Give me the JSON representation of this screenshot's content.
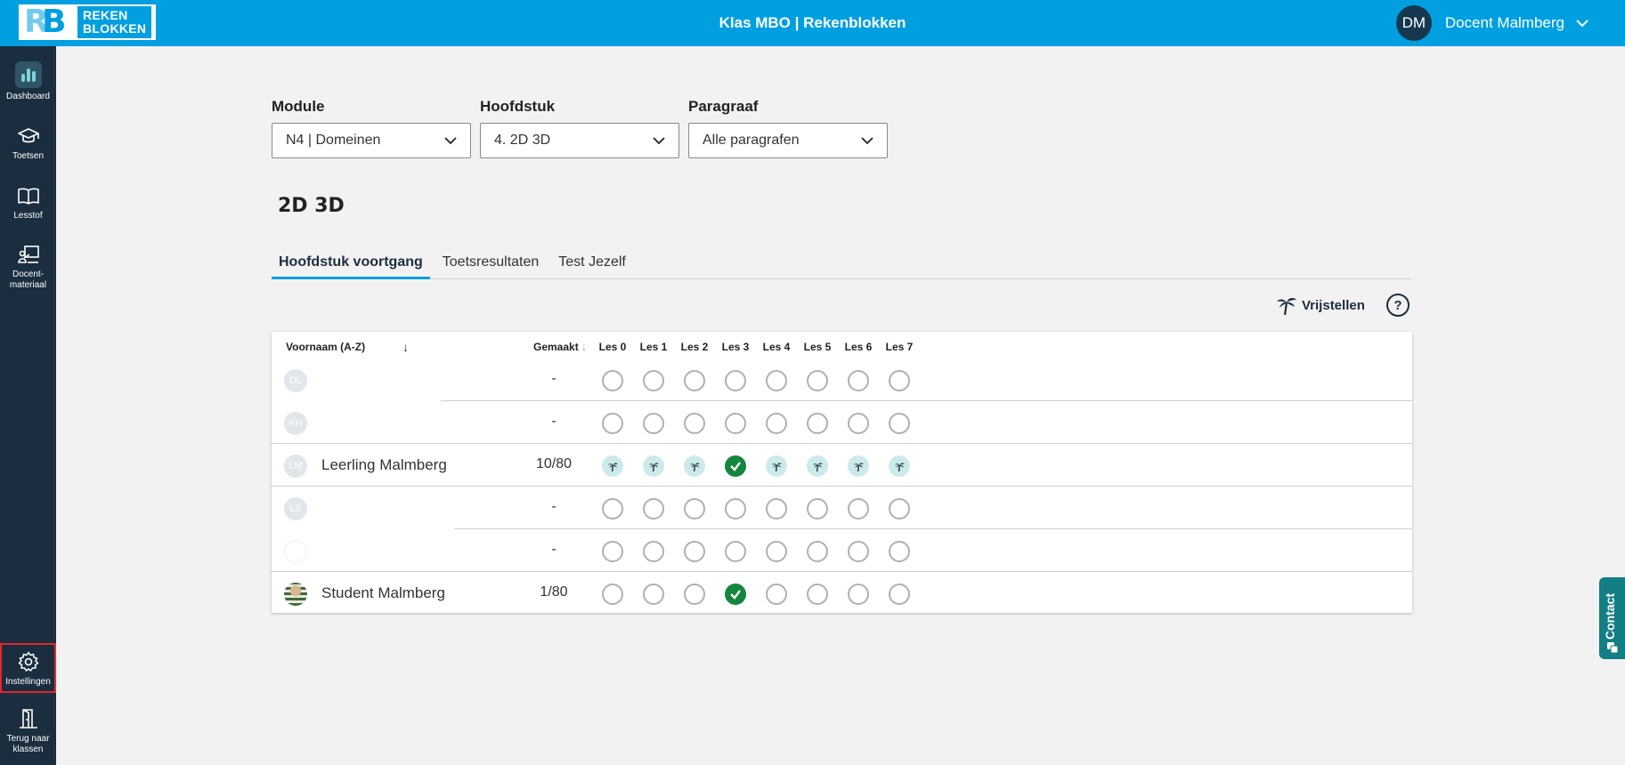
{
  "header": {
    "logo_text_line1": "REKEN",
    "logo_text_line2": "BLOKKEN",
    "logo_mark": "RB",
    "title": "Klas MBO | Rekenblokken",
    "user_initials": "DM",
    "user_name": "Docent Malmberg"
  },
  "sidebar": {
    "items": [
      {
        "label": "Dashboard",
        "icon": "bar-chart-icon"
      },
      {
        "label": "Toetsen",
        "icon": "graduation-cap-icon"
      },
      {
        "label": "Lesstof",
        "icon": "open-book-icon"
      },
      {
        "label": "Docent-materiaal",
        "label_line1": "Docent-",
        "label_line2": "materiaal",
        "icon": "teacher-board-icon"
      },
      {
        "label": "Instellingen",
        "icon": "gear-icon"
      },
      {
        "label": "Terug naar klassen",
        "label_line1": "Terug naar",
        "label_line2": "klassen",
        "icon": "door-exit-icon"
      }
    ]
  },
  "filters": {
    "module": {
      "label": "Module",
      "value": "N4 | Domeinen"
    },
    "chapter": {
      "label": "Hoofdstuk",
      "value": "4. 2D 3D"
    },
    "paragraph": {
      "label": "Paragraaf",
      "value": "Alle paragrafen"
    }
  },
  "chapter_title": "2D 3D",
  "tabs": [
    {
      "label": "Hoofdstuk voortgang",
      "active": true
    },
    {
      "label": "Toetsresultaten",
      "active": false
    },
    {
      "label": "Test Jezelf",
      "active": false
    }
  ],
  "actions": {
    "exempt_label": "Vrijstellen",
    "help_label": "?"
  },
  "table": {
    "col_name": "Voornaam (A-Z)",
    "col_name_sort": "↓",
    "col_made": "Gemaakt",
    "col_made_sort": "↓",
    "lessons": [
      "Les 0",
      "Les 1",
      "Les 2",
      "Les 3",
      "Les 4",
      "Les 5",
      "Les 6",
      "Les 7"
    ],
    "rows": [
      {
        "initials": "DL",
        "name": "",
        "made": "-",
        "status": [
          "empty",
          "empty",
          "empty",
          "empty",
          "empty",
          "empty",
          "empty",
          "empty"
        ]
      },
      {
        "initials": "KH",
        "name": "",
        "made": "-",
        "status": [
          "empty",
          "empty",
          "empty",
          "empty",
          "empty",
          "empty",
          "empty",
          "empty"
        ]
      },
      {
        "initials": "LM",
        "name": "Leerling Malmberg",
        "made": "10/80",
        "status": [
          "exempt",
          "exempt",
          "exempt",
          "done",
          "exempt",
          "exempt",
          "exempt",
          "exempt"
        ]
      },
      {
        "initials": "LS",
        "name": "",
        "made": "-",
        "status": [
          "empty",
          "empty",
          "empty",
          "empty",
          "empty",
          "empty",
          "empty",
          "empty"
        ]
      },
      {
        "initials": "",
        "name": "",
        "made": "-",
        "status": [
          "empty",
          "empty",
          "empty",
          "empty",
          "empty",
          "empty",
          "empty",
          "empty"
        ]
      },
      {
        "initials": "",
        "name": "Student Malmberg",
        "made": "1/80",
        "status": [
          "empty",
          "empty",
          "empty",
          "done",
          "empty",
          "empty",
          "empty",
          "empty"
        ]
      }
    ]
  },
  "contact_label": "Contact",
  "colors": {
    "header_blue": "#009fe0",
    "sidebar_navy": "#1b2e3f",
    "done_green": "#15863d",
    "exempt_teal": "#cdeaea",
    "highlight_red": "#e0282e"
  }
}
